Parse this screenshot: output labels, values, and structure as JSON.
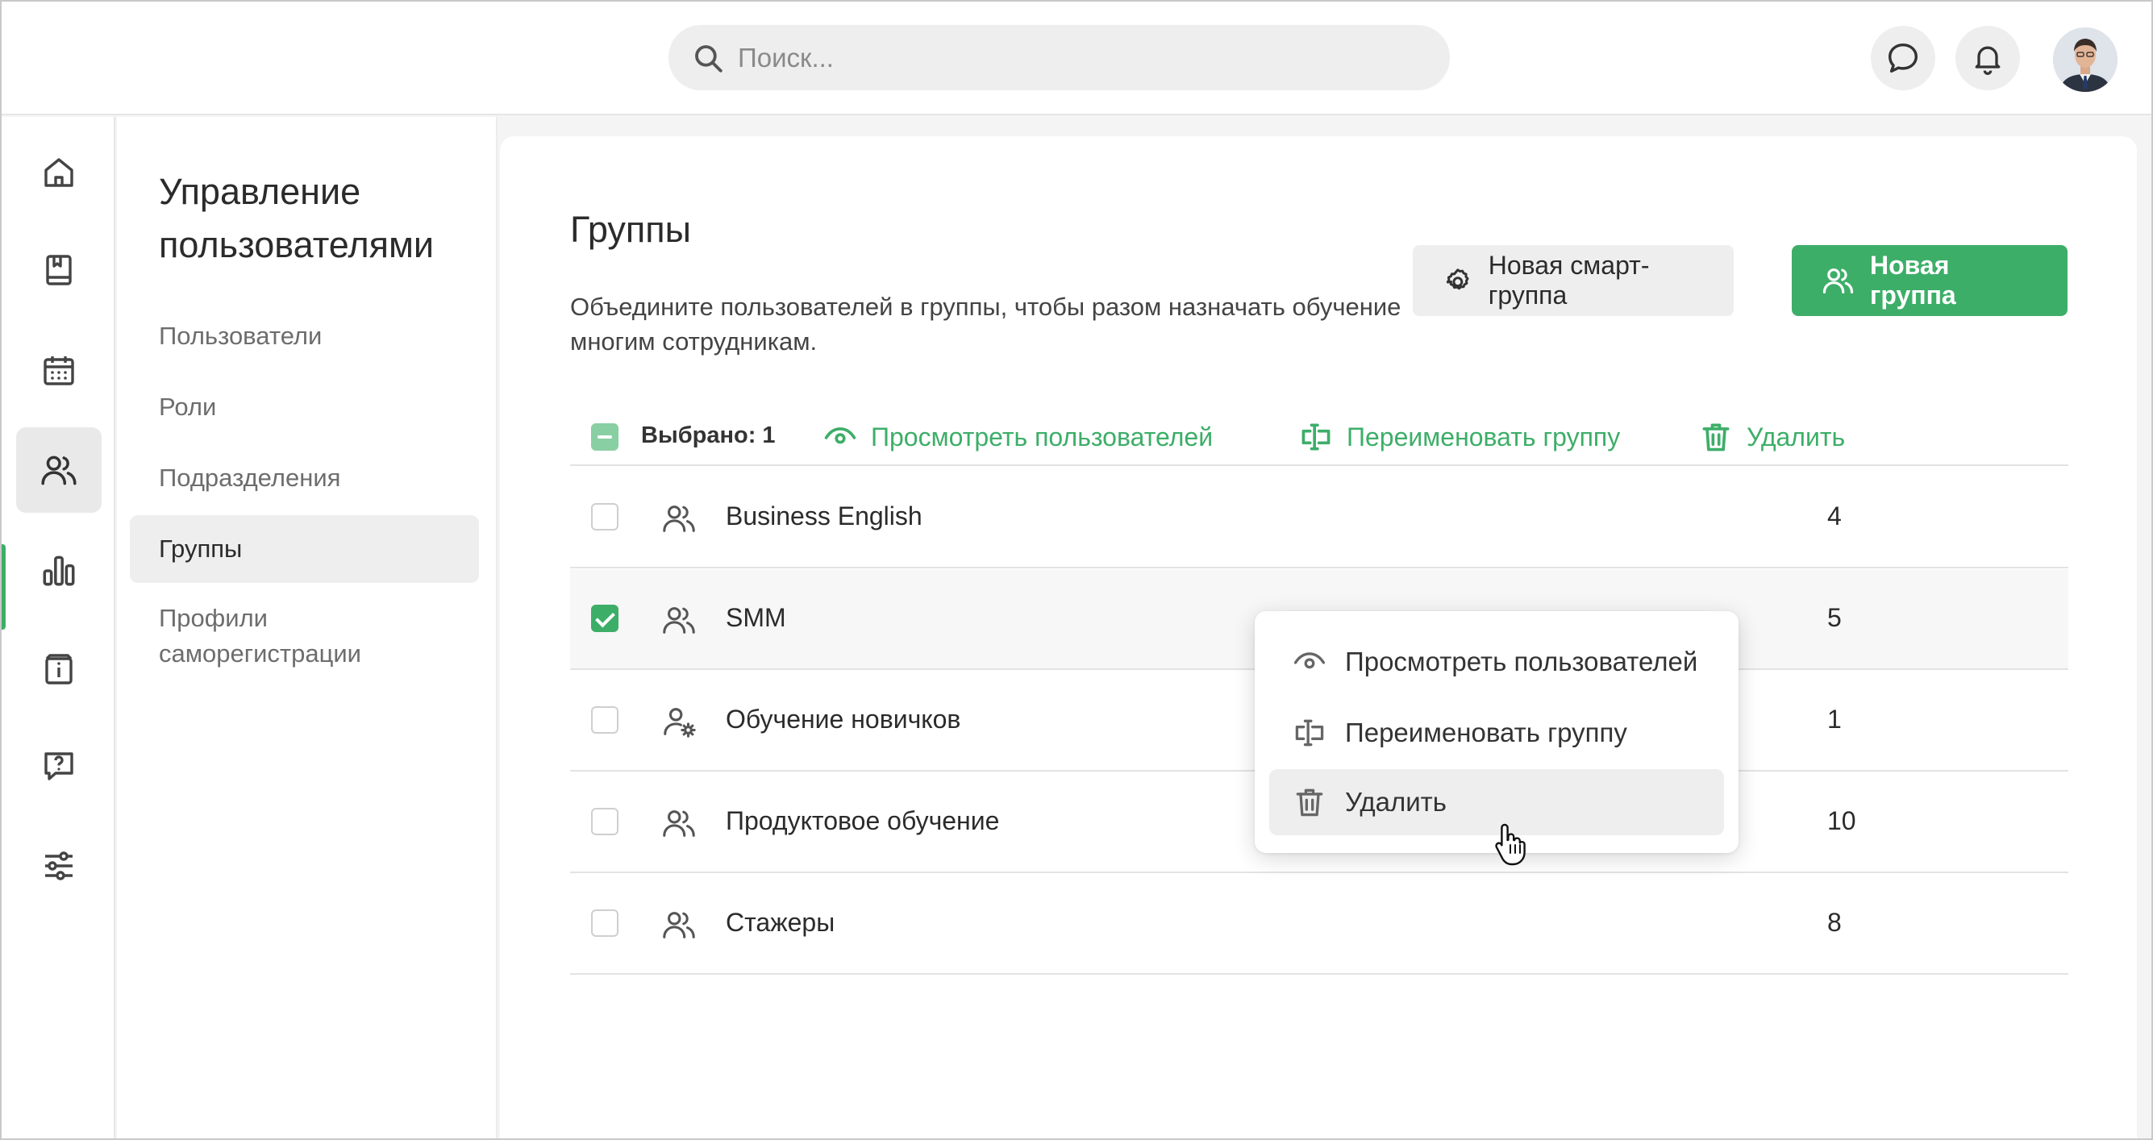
{
  "search": {
    "placeholder": "Поиск..."
  },
  "sidebar_title": "Управление пользователями",
  "subnav": {
    "users": "Пользователи",
    "roles": "Роли",
    "departments": "Подразделения",
    "groups": "Группы",
    "self_registration": "Профили саморегистрации"
  },
  "page": {
    "title": "Группы",
    "description": "Объедините пользователей в группы, чтобы разом назначать обучение многим сотрудникам.",
    "new_smart_group": "Новая смарт-группа",
    "new_group": "Новая группа"
  },
  "toolbar": {
    "selected": "Выбрано: 1",
    "view_users": "Просмотреть пользователей",
    "rename_group": "Переименовать группу",
    "delete": "Удалить"
  },
  "groups": [
    {
      "name": "Business English",
      "count": "4",
      "checked": false,
      "icon": "users-icon"
    },
    {
      "name": "SMM",
      "count": "5",
      "checked": true,
      "icon": "users-icon"
    },
    {
      "name": "Обучение новичков",
      "count": "1",
      "checked": false,
      "icon": "user-gear-icon"
    },
    {
      "name": "Продуктовое обучение",
      "count": "10",
      "checked": false,
      "icon": "users-icon"
    },
    {
      "name": "Стажеры",
      "count": "8",
      "checked": false,
      "icon": "users-icon"
    }
  ],
  "context_menu": {
    "view_users": "Просмотреть пользователей",
    "rename_group": "Переименовать группу",
    "delete": "Удалить"
  },
  "colors": {
    "accent": "#3dae68",
    "accent_light": "#89cfa4"
  }
}
